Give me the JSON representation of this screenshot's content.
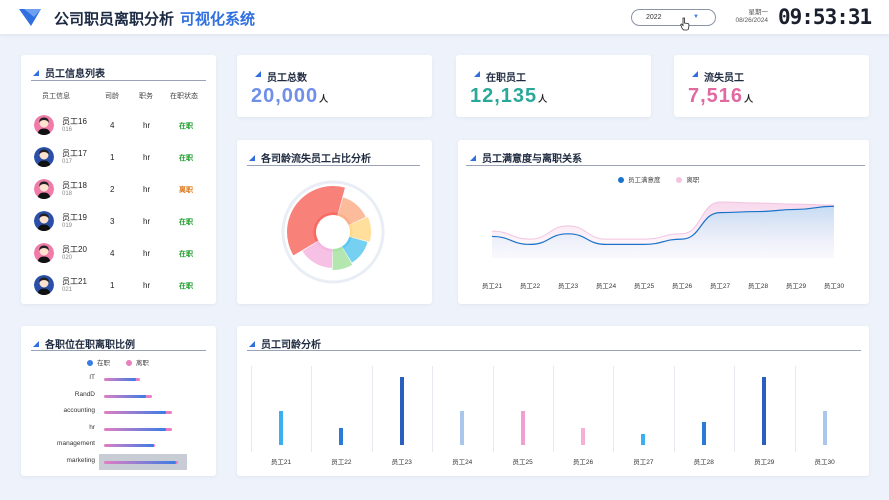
{
  "header": {
    "title": "公司职员离职分析",
    "subtitle": "可视化系统",
    "year_value": "2022",
    "weekday": "星期一",
    "date": "08/26/2024",
    "time": "09:53:31"
  },
  "employee_list": {
    "title": "员工信息列表",
    "columns": [
      "员工信息",
      "司龄",
      "职务",
      "在职状态"
    ],
    "rows": [
      {
        "name": "员工16",
        "id": "016",
        "age": "4",
        "job": "hr",
        "status": "在职",
        "gender": "female"
      },
      {
        "name": "员工17",
        "id": "017",
        "age": "1",
        "job": "hr",
        "status": "在职",
        "gender": "male"
      },
      {
        "name": "员工18",
        "id": "018",
        "age": "2",
        "job": "hr",
        "status": "离职",
        "gender": "female"
      },
      {
        "name": "员工19",
        "id": "019",
        "age": "3",
        "job": "hr",
        "status": "在职",
        "gender": "male"
      },
      {
        "name": "员工20",
        "id": "020",
        "age": "4",
        "job": "hr",
        "status": "在职",
        "gender": "female"
      },
      {
        "name": "员工21",
        "id": "021",
        "age": "1",
        "job": "hr",
        "status": "在职",
        "gender": "male"
      }
    ],
    "status_colors": {
      "在职": "#1e9e2e",
      "离职": "#e07a1a"
    }
  },
  "kpis": [
    {
      "label": "员工总数",
      "value": "20,000",
      "unit": "人",
      "color": "#6f8fe8"
    },
    {
      "label": "在职员工",
      "value": "12,135",
      "unit": "人",
      "color": "#2aa89a"
    },
    {
      "label": "流失员工",
      "value": "7,516",
      "unit": "人",
      "color": "#e06aa0"
    }
  ],
  "tenure_churn": {
    "title": "各司龄流失员工占比分析",
    "colors": [
      "#f76b63",
      "#fbb08a",
      "#ffd98a",
      "#5ec8f0",
      "#a7e3a1",
      "#f5b6e0"
    ]
  },
  "satisfaction": {
    "title": "员工满意度与离职关系",
    "legend": [
      "员工满意度",
      "离职"
    ],
    "colors": {
      "satisfaction": "#1a73c8",
      "leave": "#f2c4e0"
    }
  },
  "position_ratio": {
    "title": "各职位在职离职比例",
    "legend": [
      "在职",
      "离职"
    ],
    "colors": {
      "in_service": "#3b7be6",
      "left": "#e87fc0"
    }
  },
  "tenure_analysis": {
    "title": "员工司龄分析"
  },
  "chart_data": [
    {
      "type": "pie",
      "title": "各司龄流失员工占比分析",
      "values": [
        38,
        14,
        11,
        12,
        9,
        16
      ]
    },
    {
      "type": "area",
      "title": "员工满意度与离职关系",
      "categories": [
        "员工21",
        "员工22",
        "员工23",
        "员工24",
        "员工25",
        "员工26",
        "员工27",
        "员工28",
        "员工29",
        "员工30"
      ],
      "series": [
        {
          "name": "员工满意度",
          "values": [
            0.35,
            0.2,
            0.4,
            0.2,
            0.2,
            0.3,
            0.8,
            0.82,
            0.86,
            0.92
          ]
        },
        {
          "name": "离职",
          "values": [
            0.45,
            0.3,
            0.55,
            0.3,
            0.3,
            0.4,
            1.0,
            0.98,
            0.96,
            0.94
          ]
        }
      ]
    },
    {
      "type": "bar",
      "title": "各职位在职离职比例",
      "categories": [
        "IT",
        "RandD",
        "accounting",
        "hr",
        "management",
        "marketing"
      ],
      "series": [
        {
          "name": "在职",
          "values": [
            0.4,
            0.53,
            0.78,
            0.78,
            0.62,
            0.9
          ]
        },
        {
          "name": "离职",
          "values": [
            0.45,
            0.6,
            0.85,
            0.85,
            0.64,
            0.93
          ]
        }
      ]
    },
    {
      "type": "bar",
      "title": "员工司龄分析",
      "categories": [
        "员工21",
        "员工22",
        "员工23",
        "员工24",
        "员工25",
        "员工26",
        "员工27",
        "员工28",
        "员工29",
        "员工30"
      ],
      "values": [
        4,
        2,
        8,
        4,
        4,
        2,
        1.3,
        2.7,
        8,
        4
      ],
      "colors": [
        "#3bb0f0",
        "#2a7ad8",
        "#2a5fc0",
        "#aac6ec",
        "#f0a0d0",
        "#f5b0d8",
        "#3bb0f0",
        "#2a7ad8",
        "#2a5fc0",
        "#aac6ec"
      ]
    }
  ]
}
